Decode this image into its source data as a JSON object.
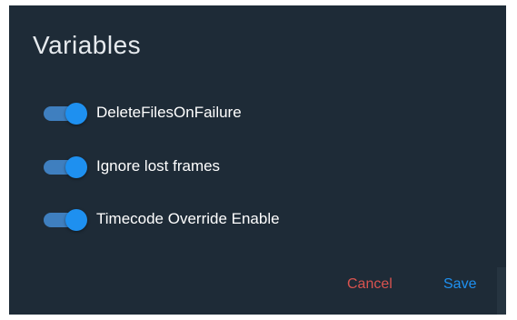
{
  "dialog": {
    "title": "Variables",
    "variables": [
      {
        "label": "DeleteFilesOnFailure",
        "enabled": true
      },
      {
        "label": "Ignore lost frames",
        "enabled": true
      },
      {
        "label": "Timecode Override Enable",
        "enabled": true
      }
    ],
    "actions": {
      "cancel_label": "Cancel",
      "save_label": "Save"
    }
  },
  "colors": {
    "dialog_background": "#1e2b37",
    "toggle_on": "#1e90f0",
    "cancel": "#d9534f",
    "save": "#1e90f0"
  }
}
